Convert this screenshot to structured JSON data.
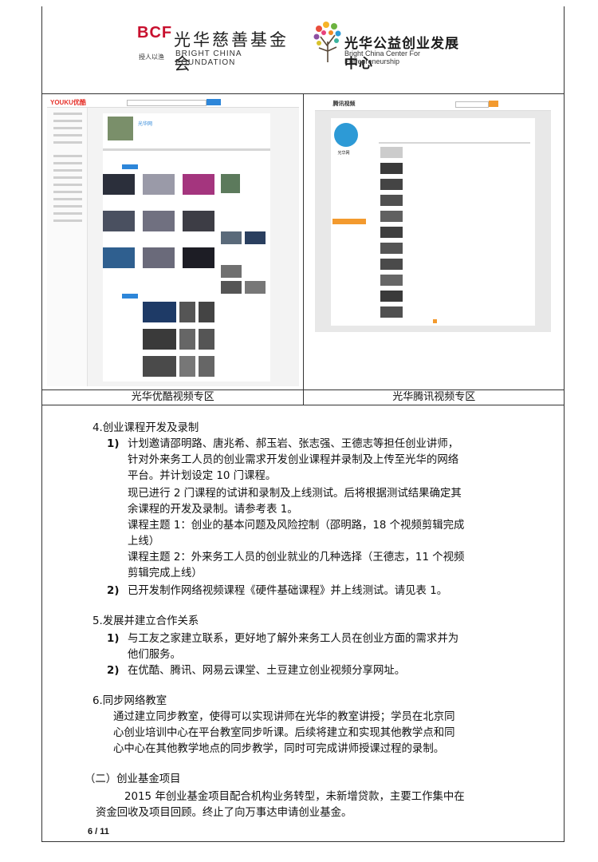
{
  "header": {
    "left_logo": {
      "mark": "BCF",
      "sub": "授人以渔",
      "name_cn": "光华慈善基金会",
      "name_en": "BRIGHT CHINA FOUNDATION"
    },
    "right_logo": {
      "name_cn": "光华公益创业发展中心",
      "name_en": "Bright China Center For Entrepreneurship"
    }
  },
  "screenshots": {
    "left_caption": "光华优酷视频专区",
    "right_caption": "光华腾讯视频专区",
    "youku_logo": "YOUKU优酷",
    "youku_channel": "光华网",
    "tencent_logo": "腾讯视频",
    "tencent_channel": "光华网"
  },
  "sections": {
    "s4_title": "4.创业课程开发及录制",
    "s4_items": [
      {
        "num": "1)",
        "lines": [
          "计划邀请邵明路、唐兆希、郝玉岩、张志强、王德志等担任创业讲师，",
          "针对外来务工人员的创业需求开发创业课程并录制及上传至光华的网络",
          "平台。并计划设定 10 门课程。",
          "现已进行 2 门课程的试讲和录制及上线测试。后将根据测试结果确定其",
          "余课程的开发及录制。请参考表 1。",
          "课程主题 1：创业的基本问题及风险控制（邵明路，18 个视频剪辑完成",
          "上线）",
          "课程主题 2：外来务工人员的创业就业的几种选择（王德志，11 个视频",
          "剪辑完成上线）"
        ]
      },
      {
        "num": "2)",
        "lines": [
          "已开发制作网络视频课程《硬件基础课程》并上线测试。请见表 1。"
        ]
      }
    ],
    "s5_title": "5.发展并建立合作关系",
    "s5_items": [
      {
        "num": "1)",
        "lines": [
          "与工友之家建立联系，更好地了解外来务工人员在创业方面的需求并为",
          "他们服务。"
        ]
      },
      {
        "num": "2)",
        "lines": [
          "在优酷、腾讯、网易云课堂、土豆建立创业视频分享网址。"
        ]
      }
    ],
    "s6_title": "6.同步网络教室",
    "s6_lines": [
      "通过建立同步教室，使得可以实现讲师在光华的教室讲授；学员在北京同",
      "心创业培训中心在平台教室同步听课。后续将建立和实现其他教学点和同",
      "心中心在其他教学地点的同步教学，同时可完成讲师授课过程的录制。"
    ],
    "p2_title": "（二）创业基金项目",
    "p2_lines": [
      "2015 年创业基金项目配合机构业务转型，未新增贷款，主要工作集中在",
      "资金回收及项目回顾。终止了向万事达申请创业基金。"
    ]
  },
  "page_number": "6 / 11",
  "colors": {
    "brand_red": "#c8102e",
    "youku_blue": "#2d86d9",
    "tencent_orange": "#f39a2e"
  }
}
